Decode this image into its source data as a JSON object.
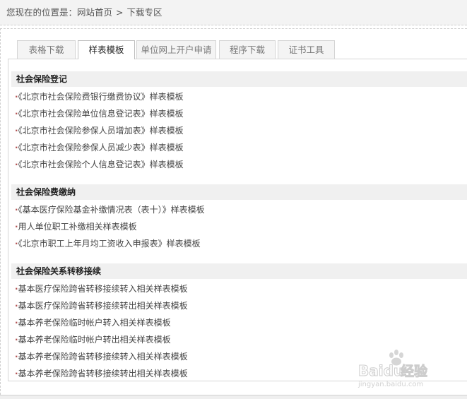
{
  "breadcrumb": {
    "prefix": "您现在的位置是：",
    "home": "网站首页",
    "separator": ">",
    "current": "下载专区"
  },
  "tabs": [
    {
      "label": "表格下载",
      "active": false
    },
    {
      "label": "样表模板",
      "active": true
    },
    {
      "label": "单位网上开户申请",
      "active": false
    },
    {
      "label": "程序下载",
      "active": false
    },
    {
      "label": "证书工具",
      "active": false
    }
  ],
  "bullet": "·",
  "sections": [
    {
      "title": "社会保险登记",
      "items": [
        "《北京市社会保险费银行缴费协议》样表模板",
        "《北京市社会保险单位信息登记表》样表模板",
        "《北京市社会保险参保人员增加表》样表模板",
        "《北京市社会保险参保人员减少表》样表模板",
        "《北京市社会保险个人信息登记表》样表模板"
      ]
    },
    {
      "title": "社会保险费缴纳",
      "items": [
        "《基本医疗保险基金补缴情况表（表十）》样表模板",
        "用人单位职工补缴相关样表模板",
        "《北京市职工上年月均工资收入申报表》样表模板"
      ]
    },
    {
      "title": "社会保险关系转移接续",
      "items": [
        "基本医疗保险跨省转移接续转入相关样表模板",
        "基本医疗保险跨省转移接续转出相关样表模板",
        "基本养老保险临时帐户转入相关样表模板",
        "基本养老保险临时帐户转出相关样表模板",
        "基本养老保险跨省转移接续转入相关样表模板",
        "基本养老保险跨省转移接续转出相关样表模板"
      ]
    }
  ],
  "watermark": {
    "brand": "Baidu",
    "cn": "经验",
    "url": "jingyan.baidu.com"
  }
}
